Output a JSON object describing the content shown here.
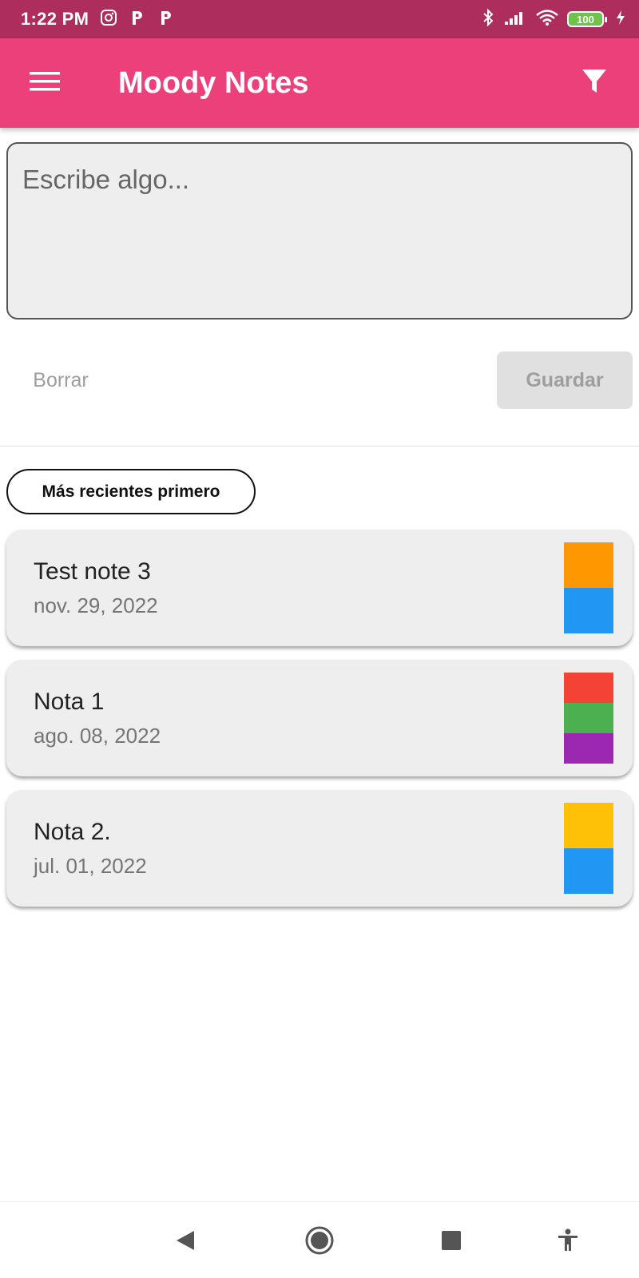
{
  "status_bar": {
    "time": "1:22 PM",
    "battery": "100",
    "notification_icons": [
      "instagram-icon",
      "parking-app-icon",
      "parking-app-icon"
    ],
    "system_icons": [
      "bluetooth-icon",
      "signal-icon",
      "wifi-icon",
      "battery-icon",
      "charging-icon"
    ]
  },
  "app_bar": {
    "title": "Moody Notes",
    "menu_icon": "hamburger-menu-icon",
    "filter_icon": "filter-icon",
    "color": "#ec407a"
  },
  "composer": {
    "placeholder": "Escribe algo...",
    "value": "",
    "clear_label": "Borrar",
    "save_label": "Guardar"
  },
  "sort": {
    "label": "Más recientes primero"
  },
  "notes": [
    {
      "title": "Test note 3",
      "date": "nov. 29, 2022",
      "mood_colors": [
        "#ff9800",
        "#2196f3"
      ]
    },
    {
      "title": "Nota 1",
      "date": "ago. 08, 2022",
      "mood_colors": [
        "#f44336",
        "#4caf50",
        "#9c27b0"
      ]
    },
    {
      "title": "Nota 2.",
      "date": "jul. 01, 2022",
      "mood_colors": [
        "#ffc107",
        "#2196f3"
      ]
    }
  ],
  "nav_bar": {
    "icons": [
      "back-icon",
      "home-icon",
      "recents-icon",
      "accessibility-icon"
    ]
  },
  "colors": {
    "status_bar": "#ad2d5c",
    "app_bar": "#ec407a",
    "card_bg": "#eeeeee"
  }
}
